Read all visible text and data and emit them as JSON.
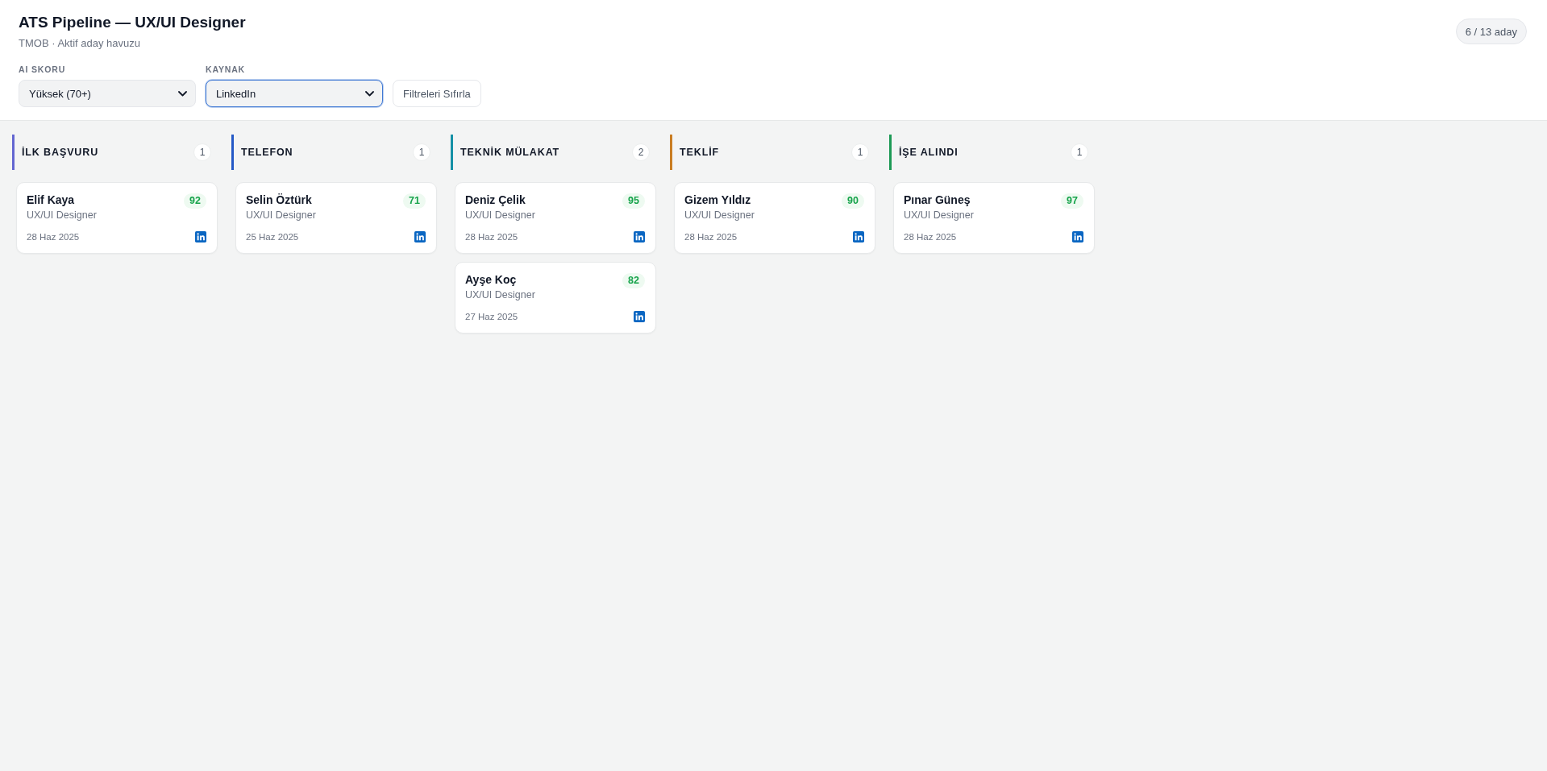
{
  "header": {
    "title": "ATS Pipeline — UX/UI Designer",
    "subtitle": "TMOB · Aktif aday havuzu",
    "count_badge": "6 / 13 aday"
  },
  "filters": [
    {
      "label": "AI SKORU",
      "value": "Yüksek (70+)",
      "focused": false
    },
    {
      "label": "KAYNAK",
      "value": "LinkedIn",
      "focused": true
    }
  ],
  "reset_button": "Filtreleri Sıfırla",
  "columns": [
    {
      "title": "İLK BAŞVURU",
      "count": "1",
      "color": "#6366d1",
      "cards": [
        {
          "name": "Elif Kaya",
          "role": "UX/UI Designer",
          "score": "92",
          "date": "28 Haz 2025"
        }
      ]
    },
    {
      "title": "TELEFON",
      "count": "1",
      "color": "#2459c6",
      "cards": [
        {
          "name": "Selin Öztürk",
          "role": "UX/UI Designer",
          "score": "71",
          "date": "25 Haz 2025"
        }
      ]
    },
    {
      "title": "TEKNİK MÜLAKAT",
      "count": "2",
      "color": "#1590a6",
      "cards": [
        {
          "name": "Deniz Çelik",
          "role": "UX/UI Designer",
          "score": "95",
          "date": "28 Haz 2025"
        },
        {
          "name": "Ayşe Koç",
          "role": "UX/UI Designer",
          "score": "82",
          "date": "27 Haz 2025"
        }
      ]
    },
    {
      "title": "TEKLİF",
      "count": "1",
      "color": "#c97d22",
      "cards": [
        {
          "name": "Gizem Yıldız",
          "role": "UX/UI Designer",
          "score": "90",
          "date": "28 Haz 2025"
        }
      ]
    },
    {
      "title": "İŞE ALINDI",
      "count": "1",
      "color": "#1d9a55",
      "cards": [
        {
          "name": "Pınar Güneş",
          "role": "UX/UI Designer",
          "score": "97",
          "date": "28 Haz 2025"
        }
      ]
    }
  ]
}
